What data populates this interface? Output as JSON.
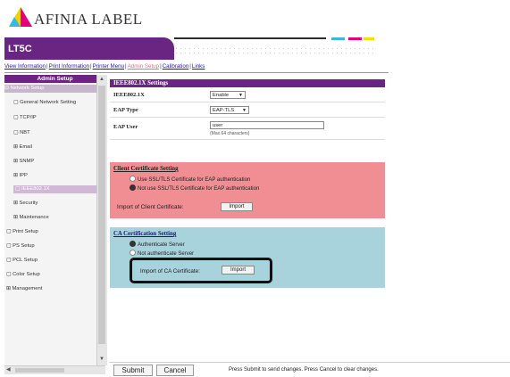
{
  "brand": {
    "name": "AFINIA LABEL",
    "product": "LT5C"
  },
  "colors": {
    "purple": "#6a2481",
    "client_bg": "#f08e93",
    "ca_bg": "#a8d3dc"
  },
  "topnav": [
    {
      "label": "View Information",
      "active": false
    },
    {
      "label": "Print Information",
      "active": false
    },
    {
      "label": "Printer Menu",
      "active": false
    },
    {
      "label": "Admin Setup",
      "active": true
    },
    {
      "label": "Calibration",
      "active": false
    },
    {
      "label": "Links",
      "active": false
    }
  ],
  "sidebar": {
    "title": "Admin Setup",
    "items": [
      {
        "label": "Network Setup",
        "icon": "collapse-icon"
      },
      {
        "label": "General Network Setting",
        "icon": "page-icon"
      },
      {
        "label": "TCP/IP",
        "icon": "page-icon"
      },
      {
        "label": "NBT",
        "icon": "page-icon"
      },
      {
        "label": "Email",
        "icon": "expand-icon"
      },
      {
        "label": "SNMP",
        "icon": "expand-icon"
      },
      {
        "label": "IPP",
        "icon": "expand-icon"
      },
      {
        "label": "IEEE802.1X",
        "icon": "page-icon"
      },
      {
        "label": "Security",
        "icon": "expand-icon"
      },
      {
        "label": "Maintenance",
        "icon": "expand-icon"
      },
      {
        "label": "Print Setup",
        "icon": "page-icon"
      },
      {
        "label": "PS Setup",
        "icon": "page-icon"
      },
      {
        "label": "PCL Setup",
        "icon": "page-icon"
      },
      {
        "label": "Color Setup",
        "icon": "page-icon"
      },
      {
        "label": "Management",
        "icon": "expand-icon"
      }
    ]
  },
  "ieee": {
    "header": "IEEE802.1X Settings",
    "rows": [
      {
        "label": "IEEE802.1X",
        "value": "Enable"
      },
      {
        "label": "EAP Type",
        "value": "EAP-TLS"
      },
      {
        "label": "EAP User",
        "value": "user",
        "hint": "(Max.64 characters)"
      }
    ]
  },
  "client_cert": {
    "title": "Client Certificate Setting",
    "options": [
      {
        "label": "Use SSL/TLS Certificate for EAP authentication",
        "selected": false
      },
      {
        "label": "Not use SSL/TLS Certificate for EAP authentication",
        "selected": true
      }
    ],
    "import_label": "Import of Client Certificate:",
    "import_button": "Import"
  },
  "ca_cert": {
    "title": "CA Certification Setting",
    "options": [
      {
        "label": "Authenticate Server",
        "selected": true
      },
      {
        "label": "Not authenticate Server",
        "selected": false
      }
    ],
    "import_label": "Import of CA Certificate:",
    "import_button": "Import"
  },
  "bottom": {
    "submit": "Submit",
    "cancel": "Cancel",
    "hint": "Press Submit to send changes. Press Cancel to clear changes."
  }
}
